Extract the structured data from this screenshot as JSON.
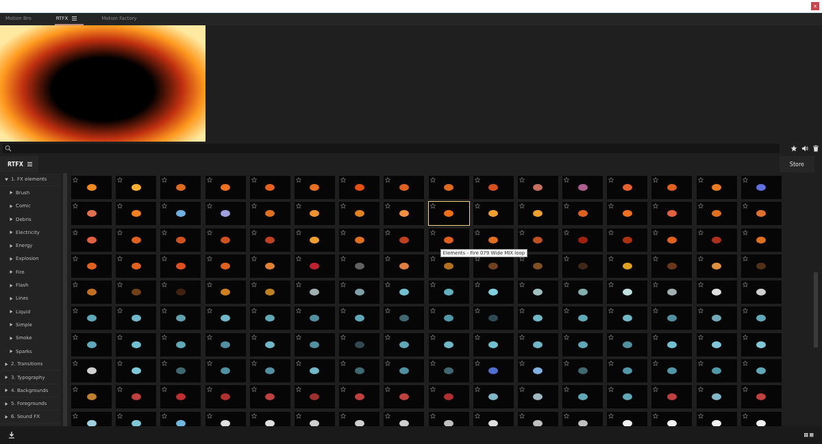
{
  "window": {
    "close": "x"
  },
  "tabs": [
    {
      "label": "Motion Bro",
      "selected": false,
      "menu": false
    },
    {
      "label": "RTFX",
      "selected": true,
      "menu": true
    },
    {
      "label": "Motion Factory",
      "selected": false,
      "menu": false
    }
  ],
  "panel_tab": {
    "label": "RTFX"
  },
  "store_button": "Store",
  "tree": [
    {
      "label": "1. FX elements",
      "expanded": true,
      "children": [
        {
          "label": "Brush",
          "expanded": false
        },
        {
          "label": "Comic",
          "expanded": false
        },
        {
          "label": "Debris",
          "expanded": false
        },
        {
          "label": "Electricity",
          "expanded": false
        },
        {
          "label": "Energy",
          "expanded": false
        },
        {
          "label": "Explosion",
          "expanded": false
        },
        {
          "label": "Fire",
          "expanded": false
        },
        {
          "label": "Flash",
          "expanded": false
        },
        {
          "label": "Lines",
          "expanded": false
        },
        {
          "label": "Liquid",
          "expanded": false
        },
        {
          "label": "Simple",
          "expanded": false
        },
        {
          "label": "Smoke",
          "expanded": false
        },
        {
          "label": "Sparks",
          "expanded": false
        }
      ]
    },
    {
      "label": "2. Transitions",
      "expanded": false
    },
    {
      "label": "3. Typography",
      "expanded": false
    },
    {
      "label": "4. Backgrounds",
      "expanded": false
    },
    {
      "label": "5. Foregrounds",
      "expanded": false
    },
    {
      "label": "6. Sound FX",
      "expanded": false
    }
  ],
  "tiles": [
    [
      {
        "color": "#f08a20",
        "selected": false
      },
      {
        "color": "#ffb030",
        "selected": false
      },
      {
        "color": "#e06a20",
        "selected": false
      },
      {
        "color": "#f07020",
        "selected": false
      },
      {
        "color": "#e86020",
        "selected": false
      },
      {
        "color": "#e87020",
        "selected": false
      },
      {
        "color": "#e85010",
        "selected": false
      },
      {
        "color": "#e06020",
        "selected": false
      },
      {
        "color": "#e06a20",
        "selected": false
      },
      {
        "color": "#d85020",
        "selected": false
      },
      {
        "color": "#c87060",
        "selected": false
      },
      {
        "color": "#b06090",
        "selected": false
      },
      {
        "color": "#e86030",
        "selected": false
      },
      {
        "color": "#e06020",
        "selected": false
      },
      {
        "color": "#f07a20",
        "selected": false
      },
      {
        "color": "#6070e0",
        "selected": false
      }
    ],
    [
      {
        "color": "#e07050",
        "selected": false
      },
      {
        "color": "#f08020",
        "selected": false
      },
      {
        "color": "#70b0e0",
        "selected": false
      },
      {
        "color": "#a0a0e0",
        "selected": false
      },
      {
        "color": "#e07020",
        "selected": false
      },
      {
        "color": "#f09030",
        "selected": false
      },
      {
        "color": "#e08020",
        "selected": false
      },
      {
        "color": "#f09040",
        "selected": false
      },
      {
        "color": "#f07018",
        "selected": true
      },
      {
        "color": "#f0a030",
        "selected": false
      },
      {
        "color": "#f0a030",
        "selected": false
      },
      {
        "color": "#e06020",
        "selected": false
      },
      {
        "color": "#f07020",
        "selected": false
      },
      {
        "color": "#e06040",
        "selected": false
      },
      {
        "color": "#e07020",
        "selected": false
      },
      {
        "color": "#e07030",
        "selected": false
      }
    ],
    [
      {
        "color": "#e06040",
        "selected": false
      },
      {
        "color": "#e06020",
        "selected": false
      },
      {
        "color": "#d05020",
        "selected": false
      },
      {
        "color": "#d05020",
        "selected": false
      },
      {
        "color": "#c04020",
        "selected": false
      },
      {
        "color": "#f0a030",
        "selected": false
      },
      {
        "color": "#e07020",
        "selected": false
      },
      {
        "color": "#c04020",
        "selected": false
      },
      {
        "color": "#e06020",
        "selected": false
      },
      {
        "color": "#e07020",
        "selected": false
      },
      {
        "color": "#c05020",
        "selected": false
      },
      {
        "color": "#a02010",
        "selected": false
      },
      {
        "color": "#b03010",
        "selected": false
      },
      {
        "color": "#e06020",
        "selected": false
      },
      {
        "color": "#b03020",
        "selected": false
      },
      {
        "color": "#e07020",
        "selected": false
      }
    ],
    [
      {
        "color": "#e06020",
        "selected": false
      },
      {
        "color": "#e06020",
        "selected": false
      },
      {
        "color": "#e05020",
        "selected": false
      },
      {
        "color": "#e06020",
        "selected": false
      },
      {
        "color": "#e08030",
        "selected": false
      },
      {
        "color": "#c02030",
        "selected": false
      },
      {
        "color": "#606060",
        "selected": false
      },
      {
        "color": "#e08040",
        "selected": false
      },
      {
        "color": "#b07020",
        "selected": false
      },
      {
        "color": "#704020",
        "selected": false
      },
      {
        "color": "#805020",
        "selected": false
      },
      {
        "color": "#402818",
        "selected": false
      },
      {
        "color": "#e0a020",
        "selected": false
      },
      {
        "color": "#6a3818",
        "selected": false
      },
      {
        "color": "#e09040",
        "selected": false
      },
      {
        "color": "#503018",
        "selected": false
      }
    ],
    [
      {
        "color": "#c07020",
        "selected": false
      },
      {
        "color": "#704018",
        "selected": false
      },
      {
        "color": "#402010",
        "selected": false
      },
      {
        "color": "#d08020",
        "selected": false
      },
      {
        "color": "#c08020",
        "selected": false
      },
      {
        "color": "#a0b0b0",
        "selected": false
      },
      {
        "color": "#80a0a8",
        "selected": false
      },
      {
        "color": "#70c0d0",
        "selected": false
      },
      {
        "color": "#60b0c0",
        "selected": false
      },
      {
        "color": "#80d0e0",
        "selected": false
      },
      {
        "color": "#a0c0c0",
        "selected": false
      },
      {
        "color": "#80b0b0",
        "selected": false
      },
      {
        "color": "#c0e0e0",
        "selected": false
      },
      {
        "color": "#a0b0b0",
        "selected": false
      },
      {
        "color": "#e0e0e0",
        "selected": false
      },
      {
        "color": "#d0d0d0",
        "selected": false
      }
    ],
    [
      {
        "color": "#60a8b8",
        "selected": false
      },
      {
        "color": "#70b8c8",
        "selected": false
      },
      {
        "color": "#60a0b0",
        "selected": false
      },
      {
        "color": "#70b8c8",
        "selected": false
      },
      {
        "color": "#60a8b8",
        "selected": false
      },
      {
        "color": "#5090a0",
        "selected": false
      },
      {
        "color": "#60a8b8",
        "selected": false
      },
      {
        "color": "#406870",
        "selected": false
      },
      {
        "color": "#5098a8",
        "selected": false
      },
      {
        "color": "#304850",
        "selected": false
      },
      {
        "color": "#70b8c8",
        "selected": false
      },
      {
        "color": "#60a8b8",
        "selected": false
      },
      {
        "color": "#70b8c8",
        "selected": false
      },
      {
        "color": "#5090a0",
        "selected": false
      },
      {
        "color": "#70a8b8",
        "selected": false
      },
      {
        "color": "#60a8b8",
        "selected": false
      }
    ],
    [
      {
        "color": "#60a8b8",
        "selected": false
      },
      {
        "color": "#70c0d0",
        "selected": false
      },
      {
        "color": "#60a8b8",
        "selected": false
      },
      {
        "color": "#5090a0",
        "selected": false
      },
      {
        "color": "#70b8c8",
        "selected": false
      },
      {
        "color": "#5090a0",
        "selected": false
      },
      {
        "color": "#304850",
        "selected": false
      },
      {
        "color": "#60a8b8",
        "selected": false
      },
      {
        "color": "#70b8c8",
        "selected": false
      },
      {
        "color": "#70c0d0",
        "selected": false
      },
      {
        "color": "#70b8c8",
        "selected": false
      },
      {
        "color": "#60a8b8",
        "selected": false
      },
      {
        "color": "#5090a0",
        "selected": false
      },
      {
        "color": "#70c0d0",
        "selected": false
      },
      {
        "color": "#80c8d8",
        "selected": false
      },
      {
        "color": "#80c8d8",
        "selected": false
      }
    ],
    [
      {
        "color": "#d0d0d0",
        "selected": false
      },
      {
        "color": "#80c8d8",
        "selected": false
      },
      {
        "color": "#406870",
        "selected": false
      },
      {
        "color": "#5090a0",
        "selected": false
      },
      {
        "color": "#5090a0",
        "selected": false
      },
      {
        "color": "#70b8c8",
        "selected": false
      },
      {
        "color": "#406870",
        "selected": false
      },
      {
        "color": "#5090a0",
        "selected": false
      },
      {
        "color": "#406870",
        "selected": false
      },
      {
        "color": "#5070d0",
        "selected": false
      },
      {
        "color": "#80b0e0",
        "selected": false
      },
      {
        "color": "#406870",
        "selected": false
      },
      {
        "color": "#5098a8",
        "selected": false
      },
      {
        "color": "#5098a8",
        "selected": false
      },
      {
        "color": "#5098a8",
        "selected": false
      },
      {
        "color": "#60a8b8",
        "selected": false
      }
    ],
    [
      {
        "color": "#c08030",
        "selected": false
      },
      {
        "color": "#c04040",
        "selected": false
      },
      {
        "color": "#c03030",
        "selected": false
      },
      {
        "color": "#b03030",
        "selected": false
      },
      {
        "color": "#c04040",
        "selected": false
      },
      {
        "color": "#a03030",
        "selected": false
      },
      {
        "color": "#c04040",
        "selected": false
      },
      {
        "color": "#c04040",
        "selected": false
      },
      {
        "color": "#b03030",
        "selected": false
      },
      {
        "color": "#80b8c8",
        "selected": false
      },
      {
        "color": "#a0b8c0",
        "selected": false
      },
      {
        "color": "#60a8b8",
        "selected": false
      },
      {
        "color": "#60a8b8",
        "selected": false
      },
      {
        "color": "#c04040",
        "selected": false
      },
      {
        "color": "#80b8c8",
        "selected": false
      },
      {
        "color": "#c04040",
        "selected": false
      }
    ],
    [
      {
        "color": "#a0d0e0",
        "selected": false
      },
      {
        "color": "#80c8d8",
        "selected": false
      },
      {
        "color": "#70b8e0",
        "selected": false
      },
      {
        "color": "#e0e0e0",
        "selected": false
      },
      {
        "color": "#e0e0e0",
        "selected": false
      },
      {
        "color": "#d0d0d0",
        "selected": false
      },
      {
        "color": "#d0d0d0",
        "selected": false
      },
      {
        "color": "#d0d0d0",
        "selected": false
      },
      {
        "color": "#c0c0c0",
        "selected": false
      },
      {
        "color": "#e0e0e0",
        "selected": false
      },
      {
        "color": "#c0c0c0",
        "selected": false
      },
      {
        "color": "#c0c0c0",
        "selected": false
      },
      {
        "color": "#f0f0f0",
        "selected": false
      },
      {
        "color": "#f0f0f0",
        "selected": false
      },
      {
        "color": "#f0f0f0",
        "selected": false
      },
      {
        "color": "#f0f0f0",
        "selected": false
      }
    ]
  ],
  "tooltip": "Elements - Fire 079 Wide MIX loop"
}
